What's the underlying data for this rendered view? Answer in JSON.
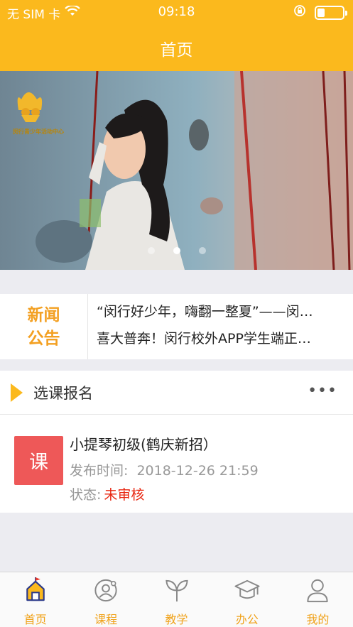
{
  "status_bar": {
    "carrier": "无 SIM 卡",
    "time": "09:18"
  },
  "nav": {
    "title": "首页"
  },
  "banner": {
    "logo_text": "闵行青少年活动中心",
    "page_count": 3,
    "active_page": 2
  },
  "news": {
    "badge_line1": "新闻",
    "badge_line2": "公告",
    "items": [
      "“闵行好少年，嗨翻一整夏”——闵…",
      "喜大普奔！闵行校外APP学生端正…"
    ]
  },
  "course_section": {
    "title": "选课报名",
    "more": "•••",
    "course": {
      "icon_text": "课",
      "name": "小提琴初级(鹤庆新招）",
      "publish_label": "发布时间:",
      "publish_time": "2018-12-26 21:59",
      "status_label": "状态:",
      "status_value": "未审核"
    }
  },
  "tabs": [
    {
      "label": "首页",
      "icon": "home-icon"
    },
    {
      "label": "课程",
      "icon": "course-icon"
    },
    {
      "label": "教学",
      "icon": "sprout-icon"
    },
    {
      "label": "办公",
      "icon": "graduation-cap-icon"
    },
    {
      "label": "我的",
      "icon": "profile-icon"
    }
  ],
  "colors": {
    "brand": "#fbb91d",
    "tab_active": "#f0a21a",
    "course_icon_bg": "#ee5858",
    "status_red": "#e8250f"
  }
}
